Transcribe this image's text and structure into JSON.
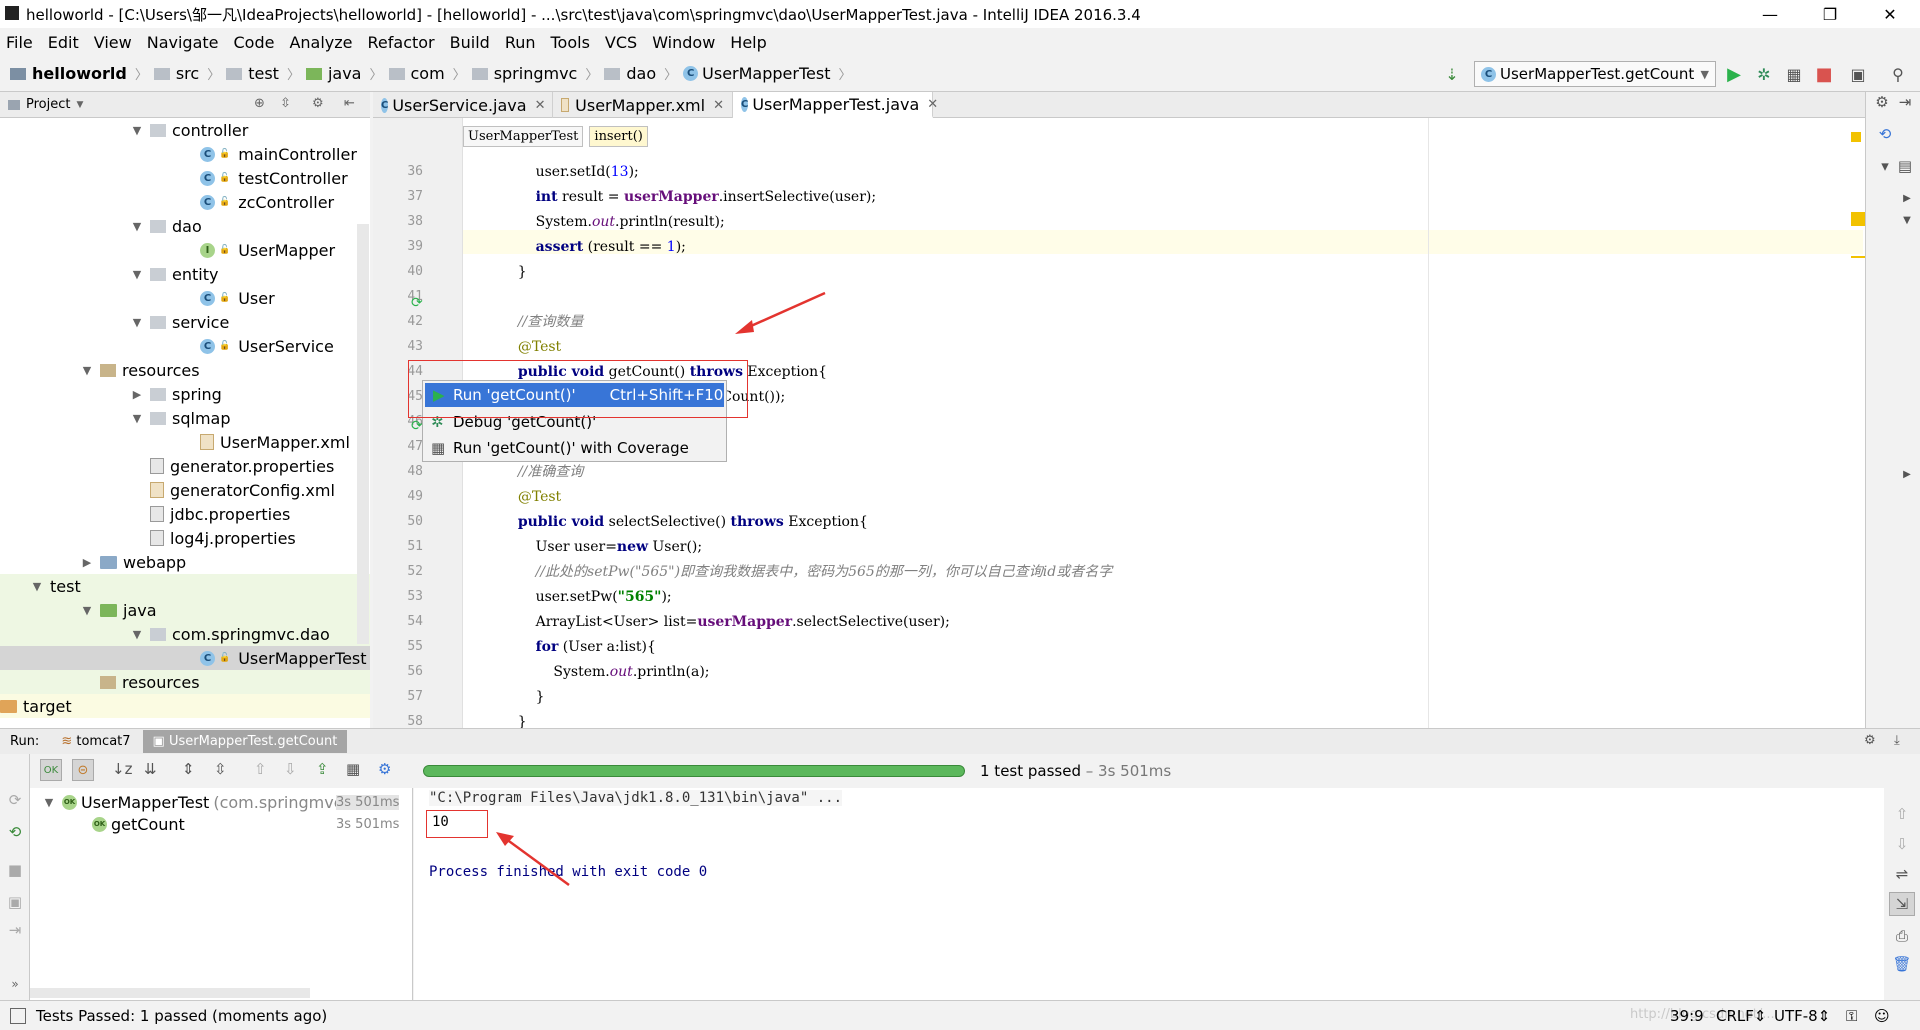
{
  "window": {
    "title": "helloworld - [C:\\Users\\邹一凡\\IdeaProjects\\helloworld] - [helloworld] - ...\\src\\test\\java\\com\\springmvc\\dao\\UserMapperTest.java - IntelliJ IDEA 2016.3.4",
    "min": "—",
    "max": "❐",
    "close": "✕"
  },
  "menu": [
    "File",
    "Edit",
    "View",
    "Navigate",
    "Code",
    "Analyze",
    "Refactor",
    "Build",
    "Run",
    "Tools",
    "VCS",
    "Window",
    "Help"
  ],
  "breadcrumbs": [
    "helloworld",
    "src",
    "test",
    "java",
    "com",
    "springmvc",
    "dao",
    "UserMapperTest"
  ],
  "run_config": "UserMapperTest.getCount",
  "project_panel": {
    "label": "Project"
  },
  "tree": [
    {
      "label": "controller",
      "indent": 2,
      "kind": "pkg",
      "arrow": "▼"
    },
    {
      "label": "mainController",
      "indent": 3,
      "kind": "class"
    },
    {
      "label": "testController",
      "indent": 3,
      "kind": "class"
    },
    {
      "label": "zcController",
      "indent": 3,
      "kind": "class"
    },
    {
      "label": "dao",
      "indent": 2,
      "kind": "pkg",
      "arrow": "▼"
    },
    {
      "label": "UserMapper",
      "indent": 3,
      "kind": "intf"
    },
    {
      "label": "entity",
      "indent": 2,
      "kind": "pkg",
      "arrow": "▼"
    },
    {
      "label": "User",
      "indent": 3,
      "kind": "class"
    },
    {
      "label": "service",
      "indent": 2,
      "kind": "pkg",
      "arrow": "▼"
    },
    {
      "label": "UserService",
      "indent": 3,
      "kind": "class"
    },
    {
      "label": "resources",
      "indent": 1,
      "kind": "res",
      "arrow": "▼"
    },
    {
      "label": "spring",
      "indent": 2,
      "kind": "pkg",
      "arrow": "▶"
    },
    {
      "label": "sqlmap",
      "indent": 2,
      "kind": "pkg",
      "arrow": "▼"
    },
    {
      "label": "UserMapper.xml",
      "indent": 3,
      "kind": "xml"
    },
    {
      "label": "generator.properties",
      "indent": 2,
      "kind": "prop"
    },
    {
      "label": "generatorConfig.xml",
      "indent": 2,
      "kind": "xml"
    },
    {
      "label": "jdbc.properties",
      "indent": 2,
      "kind": "prop"
    },
    {
      "label": "log4j.properties",
      "indent": 2,
      "kind": "prop"
    },
    {
      "label": "webapp",
      "indent": 1,
      "kind": "fold",
      "arrow": "▶"
    },
    {
      "label": "test",
      "indent": 0,
      "kind": "plain",
      "arrow": "▼",
      "green": true
    },
    {
      "label": "java",
      "indent": 1,
      "kind": "greenfold",
      "arrow": "▼",
      "green": true
    },
    {
      "label": "com.springmvc.dao",
      "indent": 2,
      "kind": "pkg",
      "arrow": "▼",
      "green": true
    },
    {
      "label": "UserMapperTest",
      "indent": 3,
      "kind": "class",
      "selected": true
    },
    {
      "label": "resources",
      "indent": 1,
      "kind": "res",
      "green": true
    },
    {
      "label": "target",
      "indent": -1,
      "kind": "orangefold",
      "arrow": "▶",
      "yellow": true
    }
  ],
  "tabs": [
    {
      "label": "UserService.java",
      "active": false
    },
    {
      "label": "UserMapper.xml",
      "active": false
    },
    {
      "label": "UserMapperTest.java",
      "active": true
    }
  ],
  "editor_crumbs": [
    "UserMapperTest",
    "insert()"
  ],
  "code_lines": [
    {
      "n": "36",
      "html": "        user.setId(<span class='num'>13</span>);"
    },
    {
      "n": "37",
      "html": "        <span class='kw'>int</span> result = <span class='fld'>userMapper</span>.insertSelective(user);"
    },
    {
      "n": "38",
      "html": "        System.<span class='sfld'>out</span>.println(result);"
    },
    {
      "n": "39",
      "html": "        <span class='kw'>assert</span> (result == <span class='num'>1</span>);"
    },
    {
      "n": "40",
      "html": "    }"
    },
    {
      "n": "41",
      "html": ""
    },
    {
      "n": "42",
      "html": "    <span class='cmt'>//查询数量</span>"
    },
    {
      "n": "43",
      "html": "    <span class='ann'>@Test</span>"
    },
    {
      "n": "44",
      "html": "    <span class='kw'>public void</span> getCount() <span class='kw'>throws</span> Exception{"
    },
    {
      "n": "45",
      "html": "                              <span class='fld'>Mapper</span>.getCount());"
    },
    {
      "n": "46",
      "html": ""
    },
    {
      "n": "47",
      "html": ""
    },
    {
      "n": "48",
      "html": "    <span class='cmt'>//准确查询</span>"
    },
    {
      "n": "49",
      "html": "    <span class='ann'>@Test</span>"
    },
    {
      "n": "50",
      "html": "    <span class='kw'>public void</span> selectSelective() <span class='kw'>throws</span> Exception{"
    },
    {
      "n": "51",
      "html": "        User user=<span class='kw'>new</span> User();"
    },
    {
      "n": "52",
      "html": "        <span class='cmt'>//此处的setPw(\"565\")即查询我数据表中，密码为565的那一列，你可以自己查询id或者名字</span>"
    },
    {
      "n": "53",
      "html": "        user.setPw(<span class='str'>\"565\"</span>);"
    },
    {
      "n": "54",
      "html": "        ArrayList&lt;User&gt; list=<span class='fld'>userMapper</span>.selectSelective(user);"
    },
    {
      "n": "55",
      "html": "        <span class='kw'>for</span> (User a:list){"
    },
    {
      "n": "56",
      "html": "            System.<span class='sfld'>out</span>.println(a);"
    },
    {
      "n": "57",
      "html": "        }"
    },
    {
      "n": "58",
      "html": "    }"
    }
  ],
  "popup": {
    "run": "Run 'getCount()'",
    "run_shortcut": "Ctrl+Shift+F10",
    "debug": "Debug 'getCount()'",
    "coverage": "Run 'getCount()' with Coverage"
  },
  "run_panel": {
    "label": "Run:",
    "tabs": [
      "tomcat7",
      "UserMapperTest.getCount"
    ],
    "status": "1 test passed",
    "duration": "– 3s 501ms"
  },
  "tests": [
    {
      "name": "UserMapperTest",
      "detail": "(com.springmvc.c",
      "time": "3s 501ms"
    },
    {
      "name": "getCount",
      "detail": "",
      "time": "3s 501ms"
    }
  ],
  "console": {
    "cmd": "\"C:\\Program Files\\Java\\jdk1.8.0_131\\bin\\java\" ...",
    "output": "10",
    "finished": "Process finished with exit code 0"
  },
  "status": {
    "message": "Tests Passed: 1 passed (moments ago)",
    "position": "39:9",
    "line_sep": "CRLF",
    "encoding": "UTF-8",
    "watermark": "http://blog.csdn.net/..."
  },
  "colors": {
    "accent": "#3875d7",
    "pass": "#5cb85c",
    "annot": "#e3342f"
  }
}
